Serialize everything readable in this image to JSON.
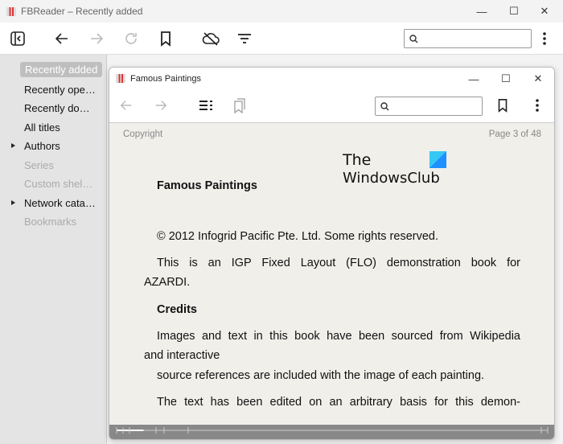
{
  "window": {
    "title": "FBReader – Recently added",
    "minimize": "—",
    "maximize": "☐",
    "close": "✕"
  },
  "toolbar": {
    "icons": [
      "sidebar-toggle-icon",
      "arrow-left-icon",
      "arrow-right-icon",
      "refresh-icon",
      "bookmark-icon",
      "cloud-off-icon",
      "filter-icon",
      "more-vertical-icon"
    ],
    "search_placeholder": ""
  },
  "sidebar": {
    "items": [
      {
        "label": "Recently added",
        "state": "selected"
      },
      {
        "label": "Recently ope…"
      },
      {
        "label": "Recently do…"
      },
      {
        "label": "All titles"
      },
      {
        "label": "Authors",
        "expandable": true
      },
      {
        "label": "Series",
        "state": "disabled"
      },
      {
        "label": "Custom shel…",
        "state": "disabled"
      },
      {
        "label": "Network cata…",
        "expandable": true
      },
      {
        "label": "Bookmarks",
        "state": "disabled"
      }
    ]
  },
  "reader": {
    "title": "Famous Paintings",
    "search_placeholder": "",
    "header_left": "Copyright",
    "header_right": "Page 3 of 48",
    "watermark": "The WindowsClub",
    "content": {
      "heading": "Famous Paintings",
      "copyright": "© 2012 Infogrid Pacific Pte. Ltd. Some rights reserved.",
      "p1a": "This is an IGP Fixed Layout (FLO) demonstration book for",
      "p1b": "AZARDI.",
      "credits": "Credits",
      "p2a": "Images and text in this book have been sourced from Wikipedia",
      "p2b": "and interactive",
      "p2c": "source references are included with the image of each painting.",
      "p3": "The text has been edited on an arbitrary basis for this demon-"
    },
    "progress": {
      "page": 3,
      "total": 48
    }
  },
  "colors": {
    "sidebar_bg": "#e4e4e4",
    "selected_bg": "#bfbfbf",
    "page_bg": "#f1efea",
    "scroll_bg": "#888888"
  }
}
